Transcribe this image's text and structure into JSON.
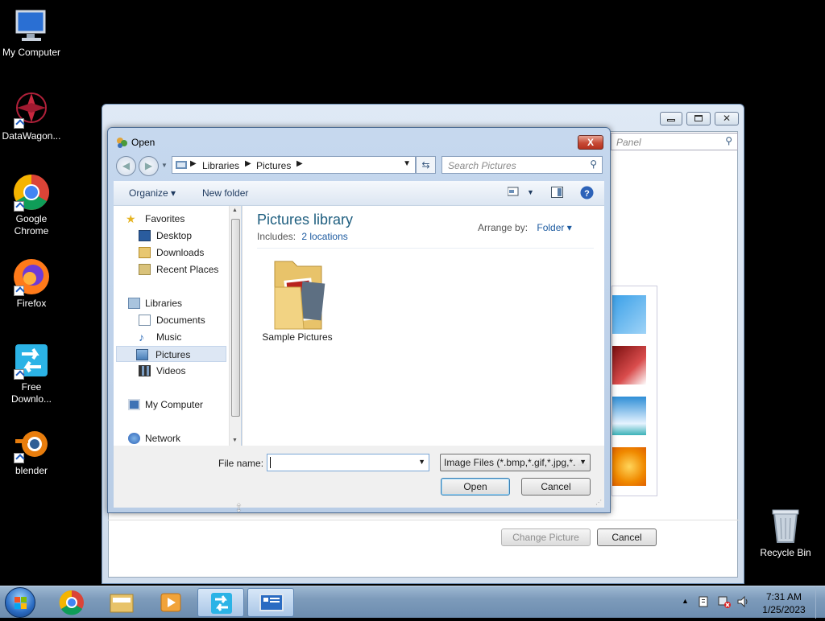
{
  "desktop": {
    "icons": [
      {
        "label": "My Computer"
      },
      {
        "label": "DataWagon..."
      },
      {
        "label": "Google Chrome"
      },
      {
        "label": "Firefox"
      },
      {
        "label": "Free Downlo..."
      },
      {
        "label": "blender"
      },
      {
        "label": "Recycle Bin"
      }
    ]
  },
  "background_window": {
    "search_placeholder": "Panel",
    "change_picture_label": "Change Picture",
    "cancel_label": "Cancel"
  },
  "dialog": {
    "title": "Open",
    "close_label": "X",
    "breadcrumb": [
      "Libraries",
      "Pictures"
    ],
    "search_placeholder": "Search Pictures",
    "toolbar": {
      "organize": "Organize",
      "new_folder": "New folder"
    },
    "nav": {
      "favorites": "Favorites",
      "desktop": "Desktop",
      "downloads": "Downloads",
      "recent": "Recent Places",
      "libraries": "Libraries",
      "documents": "Documents",
      "music": "Music",
      "pictures": "Pictures",
      "videos": "Videos",
      "computer": "My Computer",
      "network": "Network"
    },
    "content": {
      "title": "Pictures library",
      "includes_label": "Includes:",
      "includes_link": "2 locations",
      "arrange_label": "Arrange by:",
      "arrange_value": "Folder",
      "folder_name": "Sample Pictures"
    },
    "file_name_label": "File name:",
    "file_name_value": "",
    "file_type": "Image Files (*.bmp,*.gif,*.jpg,*.",
    "open_label": "Open",
    "cancel_label": "Cancel"
  },
  "taskbar": {
    "time": "7:31 AM",
    "date": "1/25/2023"
  },
  "colors": {
    "accent": "#1e5e7f",
    "link": "#1c5aa0",
    "close_red": "#c74a35"
  }
}
